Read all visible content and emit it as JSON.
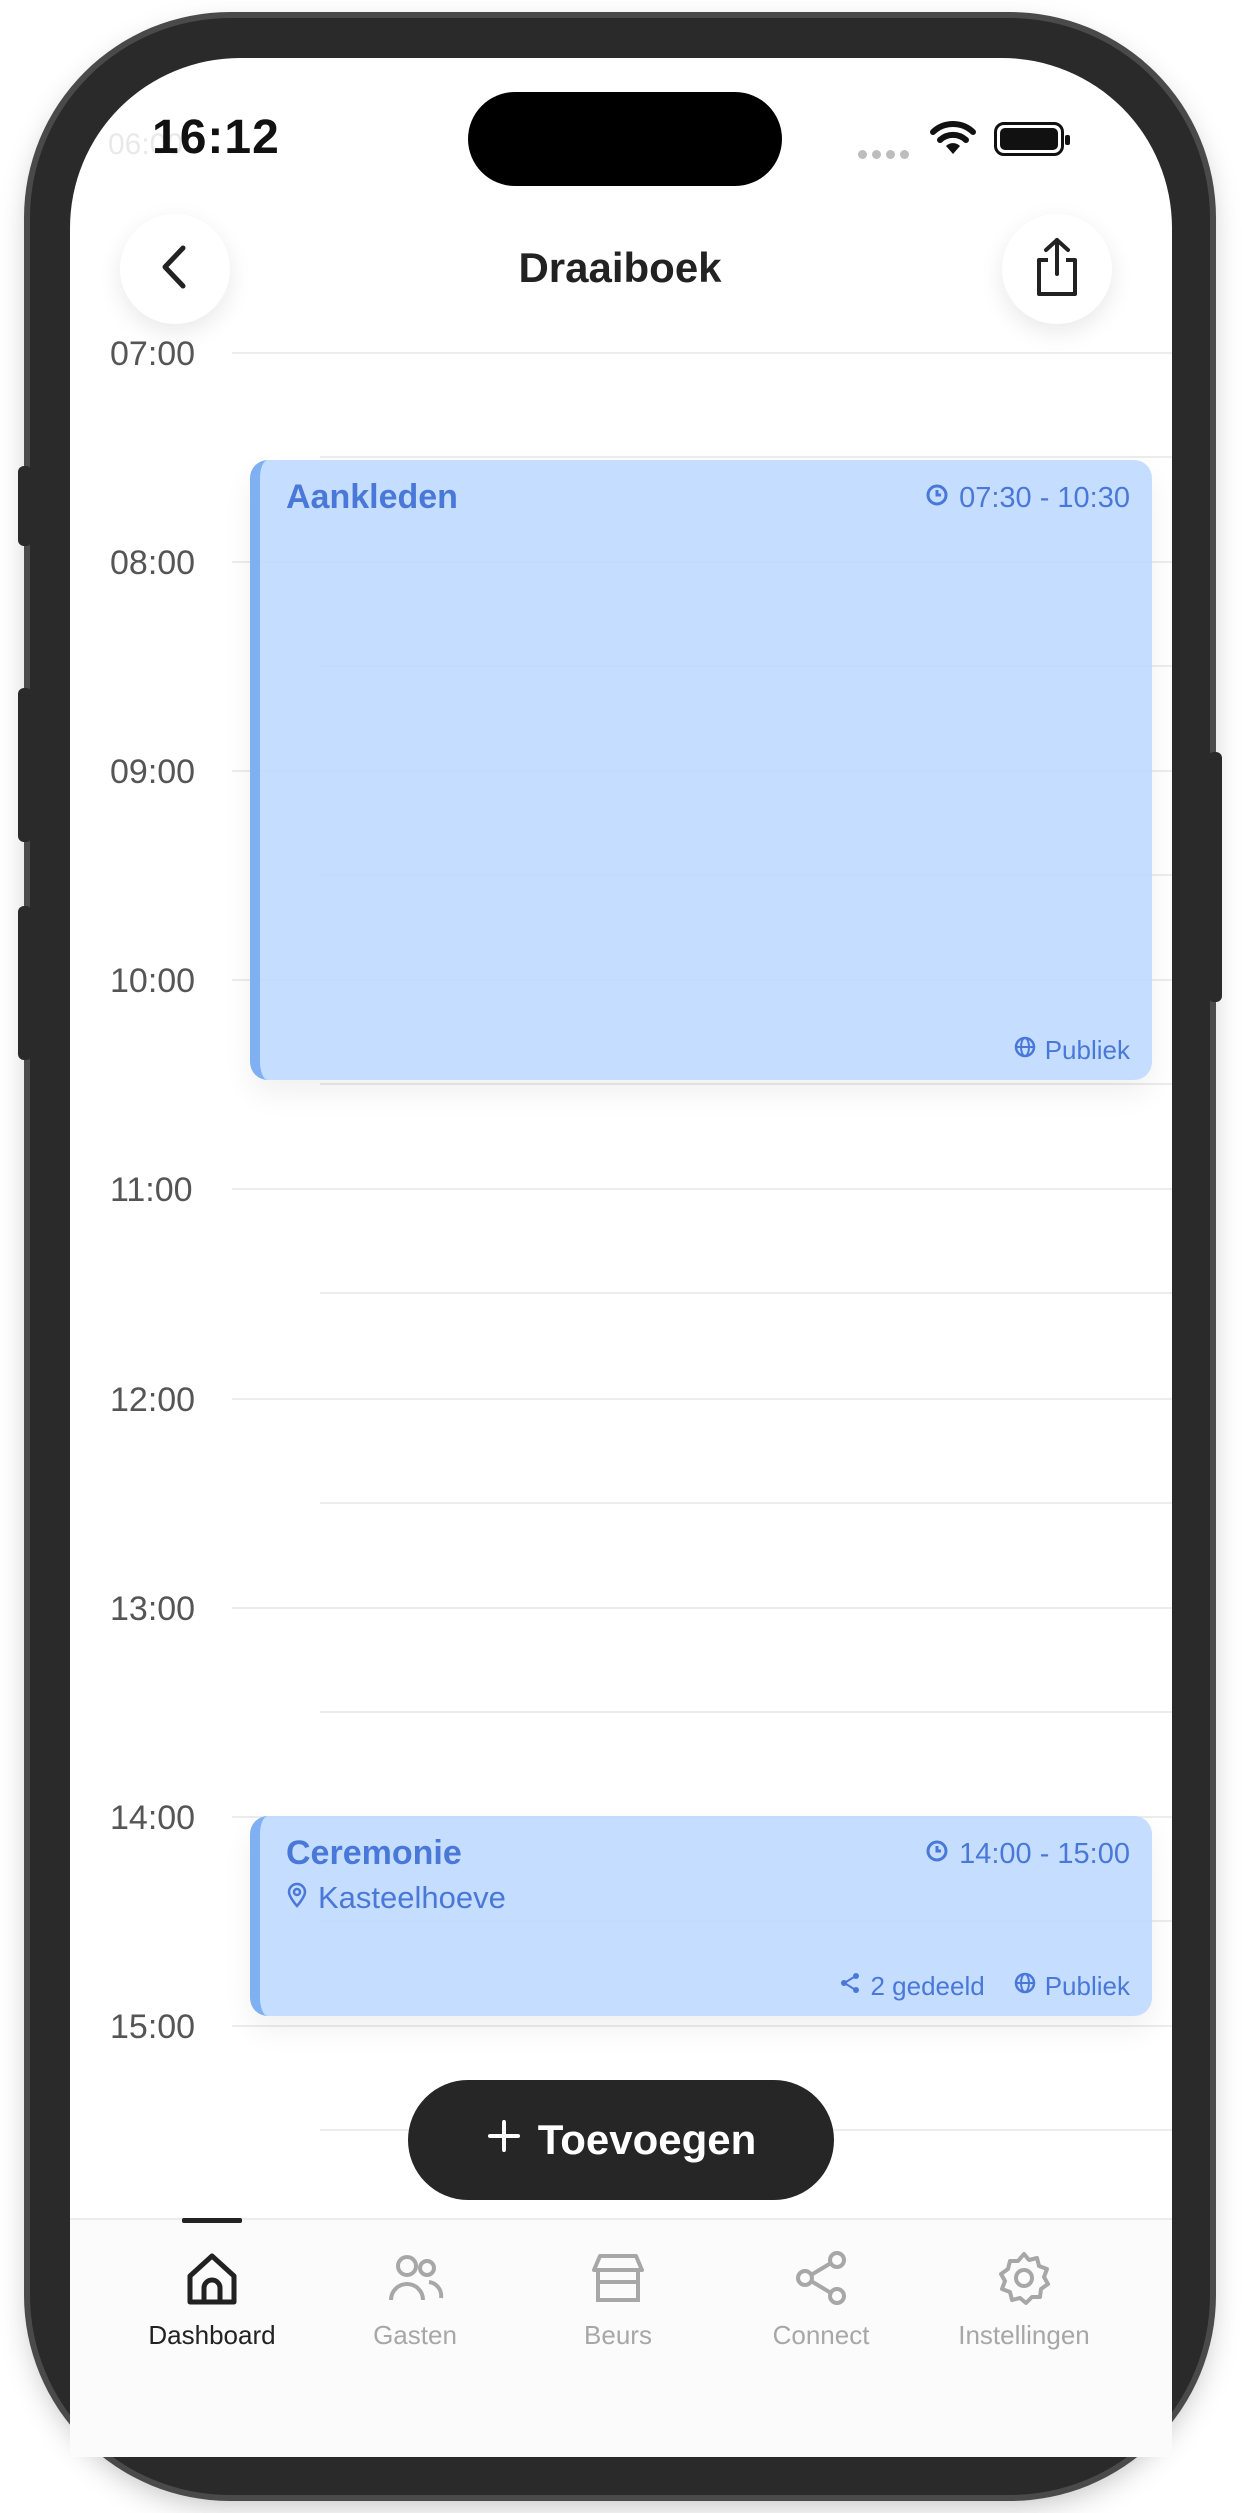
{
  "status": {
    "time": "16:12",
    "faded_time": "06:00"
  },
  "header": {
    "title": "Draaiboek",
    "back_icon": "chevron-left-icon",
    "share_icon": "share-icon"
  },
  "timeline": {
    "hours": [
      "07:00",
      "08:00",
      "09:00",
      "10:00",
      "11:00",
      "12:00",
      "13:00",
      "14:00",
      "15:00"
    ]
  },
  "events": [
    {
      "title": "Aankleden",
      "time": "07:30 - 10:30",
      "visibility": "Publiek"
    },
    {
      "title": "Ceremonie",
      "time": "14:00 - 15:00",
      "location": "Kasteelhoeve",
      "shared": "2 gedeeld",
      "visibility": "Publiek"
    }
  ],
  "add_button": {
    "label": "Toevoegen"
  },
  "tabs": [
    {
      "label": "Dashboard",
      "icon": "home-icon",
      "active": true
    },
    {
      "label": "Gasten",
      "icon": "users-icon",
      "active": false
    },
    {
      "label": "Beurs",
      "icon": "store-icon",
      "active": false
    },
    {
      "label": "Connect",
      "icon": "share-nodes-icon",
      "active": false
    },
    {
      "label": "Instellingen",
      "icon": "gear-icon",
      "active": false
    }
  ],
  "colors": {
    "accent": "#4a78d8",
    "event_bg": "#bdd9ff",
    "event_border": "#7fb0f2",
    "dark_button": "#262626"
  }
}
